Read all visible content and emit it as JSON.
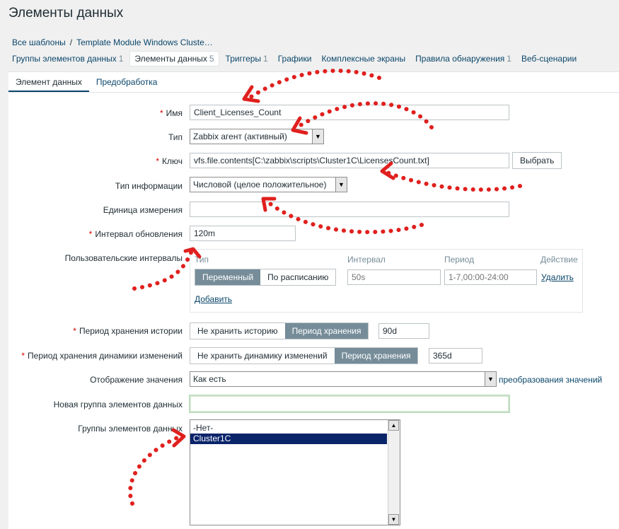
{
  "page": {
    "title": "Элементы данных"
  },
  "breadcrumb": {
    "root": "Все шаблоны",
    "sep": "/",
    "current": "Template Module Windows Cluste…"
  },
  "nav_tabs": [
    {
      "label": "Группы элементов данных",
      "count": "1"
    },
    {
      "label": "Элементы данных",
      "count": "5",
      "active": true
    },
    {
      "label": "Триггеры",
      "count": "1"
    },
    {
      "label": "Графики",
      "count": ""
    },
    {
      "label": "Комплексные экраны",
      "count": ""
    },
    {
      "label": "Правила обнаружения",
      "count": "1"
    },
    {
      "label": "Веб-сценарии",
      "count": ""
    }
  ],
  "sub_tabs": [
    {
      "label": "Элемент данных",
      "active": true
    },
    {
      "label": "Предобработка"
    }
  ],
  "form": {
    "required_mark": "*",
    "name": {
      "label": "Имя",
      "value": "Client_Licenses_Count"
    },
    "type": {
      "label": "Тип",
      "value": "Zabbix агент (активный)"
    },
    "key": {
      "label": "Ключ",
      "value": "vfs.file.contents[C:\\zabbix\\scripts\\Cluster1C\\LicensesCount.txt]",
      "button": "Выбрать"
    },
    "info_type": {
      "label": "Тип информации",
      "value": "Числовой (целое положительное)"
    },
    "units": {
      "label": "Единица измерения",
      "value": ""
    },
    "update_interval": {
      "label": "Интервал обновления",
      "value": "120m"
    },
    "custom_intervals": {
      "label": "Пользовательские интервалы",
      "headers": {
        "type": "Тип",
        "interval": "Интервал",
        "period": "Период",
        "action": "Действие"
      },
      "row": {
        "mode_flexible": "Переменный",
        "mode_scheduling": "По расписанию",
        "interval_placeholder": "50s",
        "period_placeholder": "1-7,00:00-24:00",
        "remove": "Удалить"
      },
      "add": "Добавить"
    },
    "history": {
      "label": "Период хранения истории",
      "opt_off": "Не хранить историю",
      "opt_on": "Период хранения",
      "value": "90d"
    },
    "trends": {
      "label": "Период хранения динамики изменений",
      "opt_off": "Не хранить динамику изменений",
      "opt_on": "Период хранения",
      "value": "365d"
    },
    "value_map": {
      "label": "Отображение значения",
      "value": "Как есть",
      "link": "преобразования значений"
    },
    "new_app": {
      "label": "Новая группа элементов данных",
      "value": ""
    },
    "apps": {
      "label": "Группы элементов данных",
      "options": [
        "-Нет-",
        "Cluster1C"
      ],
      "selected": "Cluster1C"
    }
  },
  "colors": {
    "accent": "#0a466a",
    "annotation": "#e0201e",
    "selected": "#0a246a"
  },
  "icons": {
    "dropdown": "triangle-down-icon",
    "scroll_up": "triangle-up-icon"
  }
}
